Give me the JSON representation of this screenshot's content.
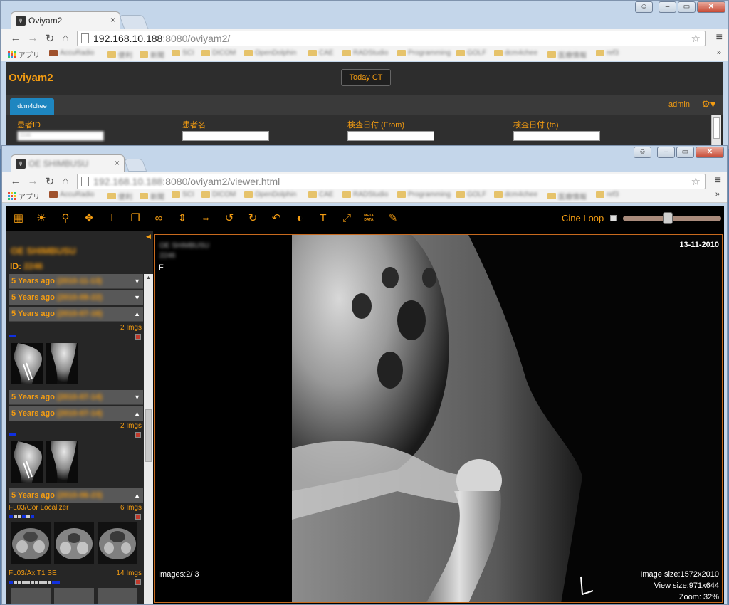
{
  "back_window": {
    "tab_title": "Oviyam2",
    "tab_close": "×",
    "url_host": "192.168.10.188",
    "url_rest": ":8080/oviyam2/",
    "apps_label": "アプリ",
    "bookmarks": [
      "AccuRadio",
      "便利",
      "新聞",
      "SCI",
      "DICOM",
      "OpenDolphin",
      "CAE",
      "RADStudio",
      "Programming",
      "GOLF",
      "dcm4chee",
      "医療情報",
      "ref3"
    ],
    "more": "»",
    "page": {
      "logo": "Oviyam2",
      "today_button": "Today CT",
      "server_tab": "dcm4chee",
      "user": "admin",
      "search_fields": [
        {
          "label": "患者ID",
          "value": "2246"
        },
        {
          "label": "患者名",
          "value": ""
        },
        {
          "label": "検査日付 (From)",
          "value": ""
        },
        {
          "label": "検査日付 (to)",
          "value": ""
        }
      ]
    }
  },
  "front_window": {
    "tab_title": "OE SHIMBUSU",
    "tab_close": "×",
    "url_host": "192.168.10.188",
    "url_rest": ":8080/oviyam2/viewer.html",
    "apps_label": "アプリ",
    "bookmarks": [
      "AccuRadio",
      "便利",
      "新聞",
      "SCI",
      "DICOM",
      "OpenDolphin",
      "CAE",
      "RADStudio",
      "Programming",
      "GOLF",
      "dcm4chee",
      "医療情報",
      "ref3"
    ],
    "more": "»"
  },
  "viewer": {
    "toolbar": {
      "meta_label_1": "META",
      "meta_label_2": "DATA",
      "cine_label": "Cine Loop",
      "cine_position": 0.45
    },
    "patient": {
      "name": "OE SHIMBUSU",
      "id_label": "ID:",
      "id_value": "2246"
    },
    "studies": [
      {
        "label": "5 Years ago",
        "date": "(2010-11-13)",
        "expanded": false
      },
      {
        "label": "5 Years ago",
        "date": "(2010-09-22)",
        "expanded": false
      },
      {
        "label": "5 Years ago",
        "date": "(2010-07-16)",
        "expanded": true,
        "series": [
          {
            "name": "",
            "count": "2 Imgs"
          }
        ]
      },
      {
        "label": "5 Years ago",
        "date": "(2010-07-14)",
        "expanded": false
      },
      {
        "label": "5 Years ago",
        "date": "(2010-07-14)",
        "expanded": true,
        "series": [
          {
            "name": "",
            "count": "2 Imgs"
          }
        ]
      },
      {
        "label": "5 Years ago",
        "date": "(2010-06-23)",
        "expanded": true,
        "series": [
          {
            "name": "FL03/Cor Localizer",
            "count": "6 Imgs"
          },
          {
            "name": "FL03/Ax T1 SE",
            "count": "14 Imgs"
          }
        ]
      }
    ],
    "overlay": {
      "top_left_1": "OE SHIMBUSU",
      "top_left_2": "2246",
      "orientation": "F",
      "date": "13-11-2010",
      "images": "Images:2/ 3",
      "image_size": "Image size:1572x2010",
      "view_size": "View size:971x644",
      "zoom": "Zoom: 32%",
      "marker": "L"
    }
  }
}
